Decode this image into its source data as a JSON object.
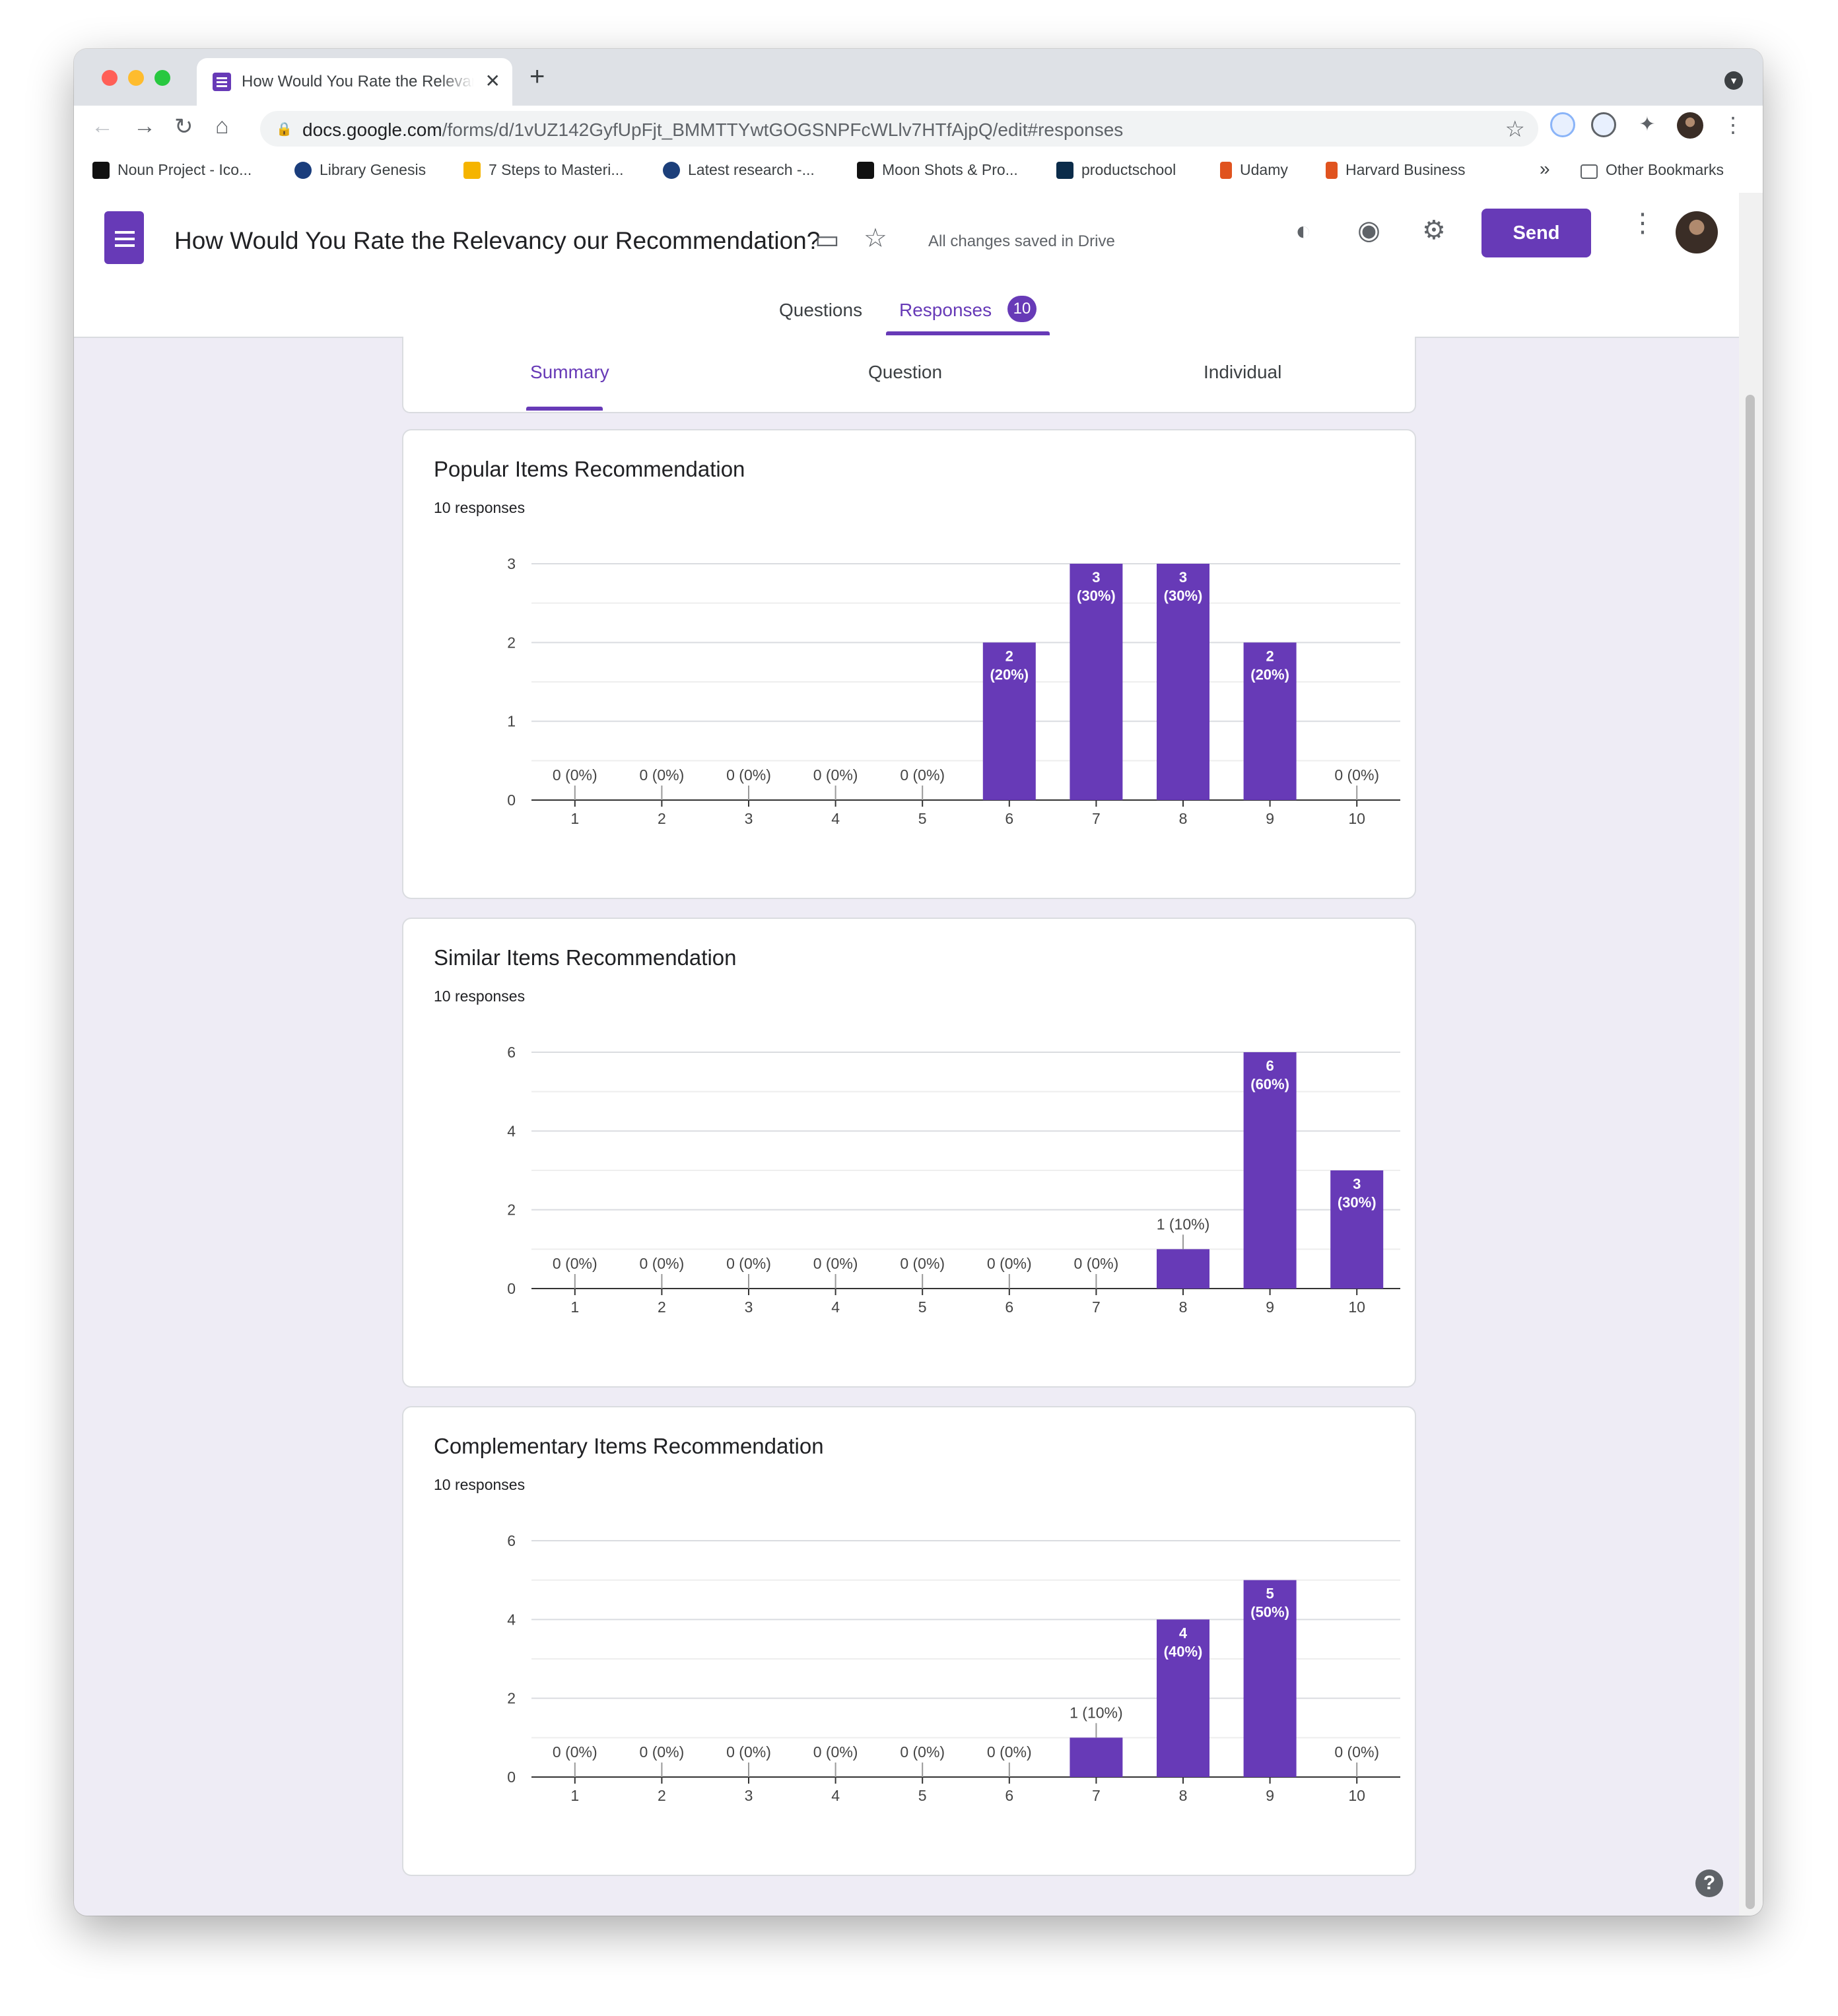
{
  "browser": {
    "tab_title": "How Would You Rate the Relevancy our Recommendation?",
    "new_tab_icon": "plus-icon",
    "url_host": "docs.google.com",
    "url_path": "/forms/d/1vUZ142GyfUpFjt_BMMTTYwtGOGSNPFcWLlv7HTfAjpQ/edit#responses",
    "bookmarks": [
      {
        "label": "Noun Project - Ico...",
        "color": "#111111"
      },
      {
        "label": "Library Genesis",
        "color": "#1a3d7c"
      },
      {
        "label": "7 Steps to Masteri...",
        "color": "#f5b400"
      },
      {
        "label": "Latest research -...",
        "color": "#1c3f7a"
      },
      {
        "label": "Moon Shots & Pro...",
        "color": "#111111"
      },
      {
        "label": "productschool",
        "color": "#0b2c4a"
      },
      {
        "label": "Udamy",
        "color": "#e0531f"
      },
      {
        "label": "Harvard Business",
        "color": "#e0531f"
      }
    ],
    "bookmarks_overflow": "»",
    "other_bookmarks": "Other Bookmarks"
  },
  "form": {
    "title": "How Would You Rate the Relevancy our Recommendation?",
    "save_status": "All changes saved in Drive",
    "send_label": "Send",
    "tabs": {
      "questions": "Questions",
      "responses": "Responses",
      "responses_count": "10"
    },
    "subtabs": {
      "summary": "Summary",
      "question": "Question",
      "individual": "Individual"
    },
    "accent_color": "#673ab7"
  },
  "cards": [
    {
      "title": "Popular Items Recommendation",
      "responses": "10 responses"
    },
    {
      "title": "Similar Items Recommendation",
      "responses": "10 responses"
    },
    {
      "title": "Complementary Items Recommendation",
      "responses": "10 responses"
    }
  ],
  "chart_data": [
    {
      "type": "bar",
      "title": "Popular Items Recommendation",
      "categories": [
        "1",
        "2",
        "3",
        "4",
        "5",
        "6",
        "7",
        "8",
        "9",
        "10"
      ],
      "values": [
        0,
        0,
        0,
        0,
        0,
        2,
        3,
        3,
        2,
        0
      ],
      "percent_labels": [
        "0%",
        "0%",
        "0%",
        "0%",
        "0%",
        "20%",
        "30%",
        "30%",
        "20%",
        "0%"
      ],
      "ylim": [
        0,
        3
      ],
      "yticks": [
        0,
        1,
        2,
        3
      ],
      "color": "#673ab7",
      "grid": true
    },
    {
      "type": "bar",
      "title": "Similar Items Recommendation",
      "categories": [
        "1",
        "2",
        "3",
        "4",
        "5",
        "6",
        "7",
        "8",
        "9",
        "10"
      ],
      "values": [
        0,
        0,
        0,
        0,
        0,
        0,
        0,
        1,
        6,
        3
      ],
      "percent_labels": [
        "0%",
        "0%",
        "0%",
        "0%",
        "0%",
        "0%",
        "0%",
        "10%",
        "60%",
        "30%"
      ],
      "ylim": [
        0,
        6
      ],
      "yticks": [
        0,
        2,
        4,
        6
      ],
      "color": "#673ab7",
      "grid": true
    },
    {
      "type": "bar",
      "title": "Complementary Items Recommendation",
      "categories": [
        "1",
        "2",
        "3",
        "4",
        "5",
        "6",
        "7",
        "8",
        "9",
        "10"
      ],
      "values": [
        0,
        0,
        0,
        0,
        0,
        0,
        1,
        4,
        5,
        0
      ],
      "percent_labels": [
        "0%",
        "0%",
        "0%",
        "0%",
        "0%",
        "0%",
        "10%",
        "40%",
        "50%",
        "0%"
      ],
      "ylim": [
        0,
        6
      ],
      "yticks": [
        0,
        2,
        4,
        6
      ],
      "color": "#673ab7",
      "grid": true
    }
  ],
  "help_label": "?"
}
